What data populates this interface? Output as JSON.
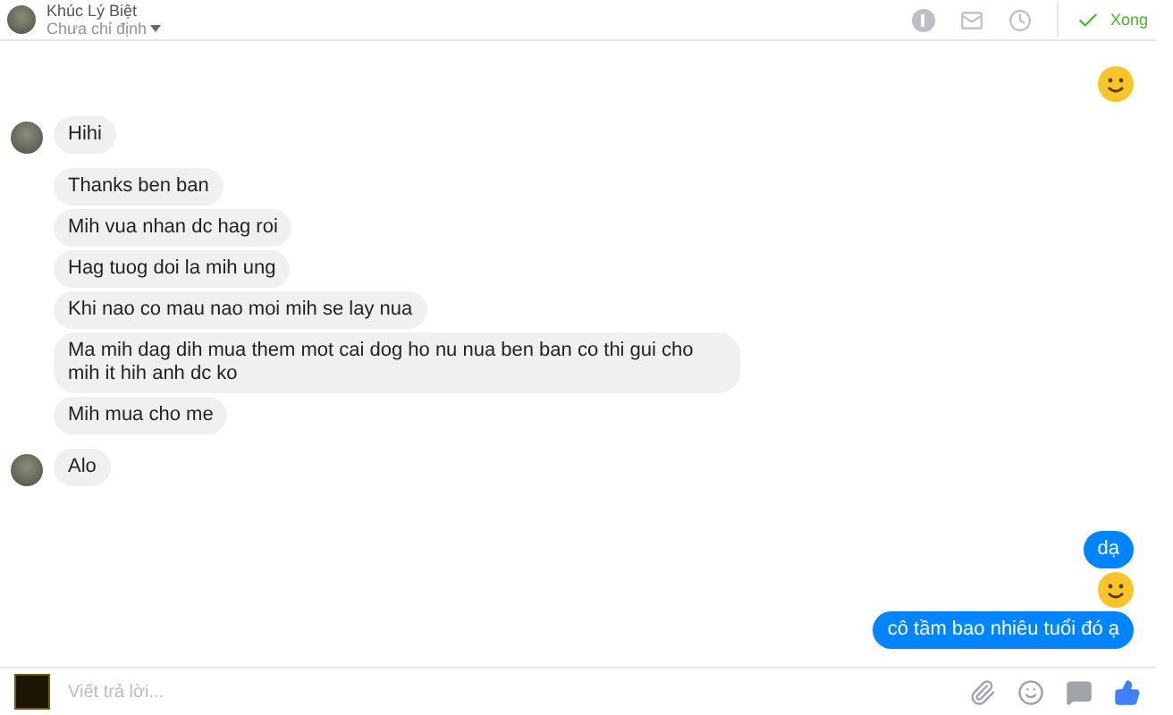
{
  "header": {
    "name": "Khúc Lý Biệt",
    "status": "Chưa chỉ định",
    "done_label": "Xong"
  },
  "thread": [
    {
      "outgoing": true,
      "messages": [
        {
          "kind": "emoji"
        }
      ]
    },
    {
      "outgoing": false,
      "avatar": true,
      "messages": [
        {
          "kind": "text",
          "text": "Hihi"
        }
      ]
    },
    {
      "outgoing": false,
      "avatar": false,
      "messages": [
        {
          "kind": "text",
          "text": "Thanks ben ban"
        },
        {
          "kind": "text",
          "text": "Mih vua nhan dc hag roi"
        },
        {
          "kind": "text",
          "text": "Hag tuog doi la mih ung"
        },
        {
          "kind": "text",
          "text": "Khi nao co mau nao moi mih se lay nua"
        },
        {
          "kind": "text",
          "text": "Ma mih dag dih mua them mot cai dog ho nu nua ben ban co thi gui cho mih it hih anh dc ko"
        },
        {
          "kind": "text",
          "text": "Mih mua cho me"
        }
      ]
    },
    {
      "outgoing": false,
      "avatar": true,
      "messages": [
        {
          "kind": "text",
          "text": "Alo"
        }
      ]
    },
    {
      "outgoing": true,
      "messages": [
        {
          "kind": "text",
          "text": "dạ"
        },
        {
          "kind": "emoji"
        },
        {
          "kind": "text",
          "text": "cô tầm bao nhiêu tuổi đó ạ"
        }
      ]
    }
  ],
  "composer": {
    "placeholder": "Viết trả lời..."
  }
}
